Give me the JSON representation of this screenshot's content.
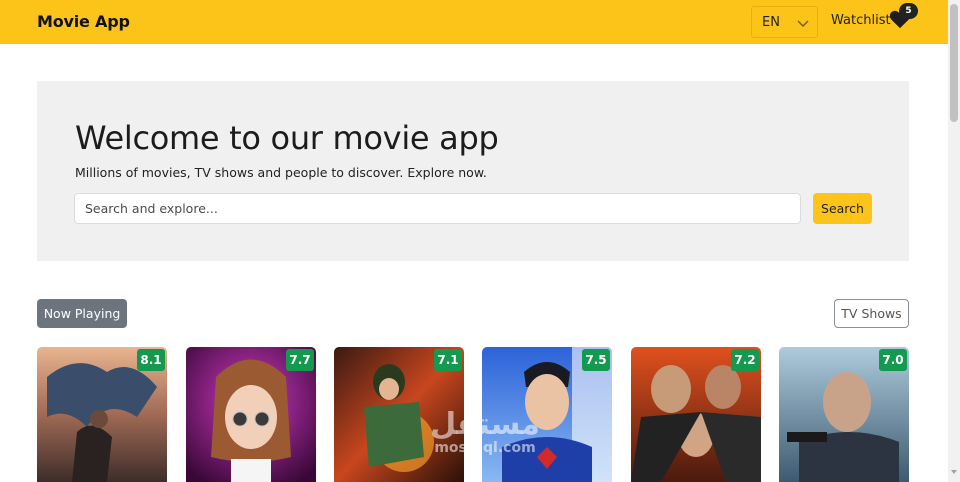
{
  "navbar": {
    "brand": "Movie App",
    "language": "EN",
    "watchlist_label": "Watchlist",
    "watchlist_count": "5",
    "background": "#fcc419"
  },
  "hero": {
    "title": "Welcome to our movie app",
    "subtitle": "Millions of movies, TV shows and people to discover. Explore now.",
    "search_placeholder": "Search and explore...",
    "search_button": "Search"
  },
  "tabs": {
    "now_playing": "Now Playing",
    "tv_shows": "TV Shows"
  },
  "movies": [
    {
      "rating": "8.1",
      "icon": "dragon-poster"
    },
    {
      "rating": "7.7",
      "icon": "doll-poster"
    },
    {
      "rating": "7.1",
      "icon": "warrior-poster"
    },
    {
      "rating": "7.5",
      "icon": "superhero-poster"
    },
    {
      "rating": "7.2",
      "icon": "action-trio-poster"
    },
    {
      "rating": "7.0",
      "icon": "snow-gunman-poster"
    }
  ],
  "watermark": {
    "arabic": "مستقل",
    "latin": "mostaql.com"
  },
  "colors": {
    "accent": "#fcc419",
    "rating_badge": "#149a4e",
    "hero_bg": "#f1f0f0",
    "active_tab": "#6c757d"
  }
}
